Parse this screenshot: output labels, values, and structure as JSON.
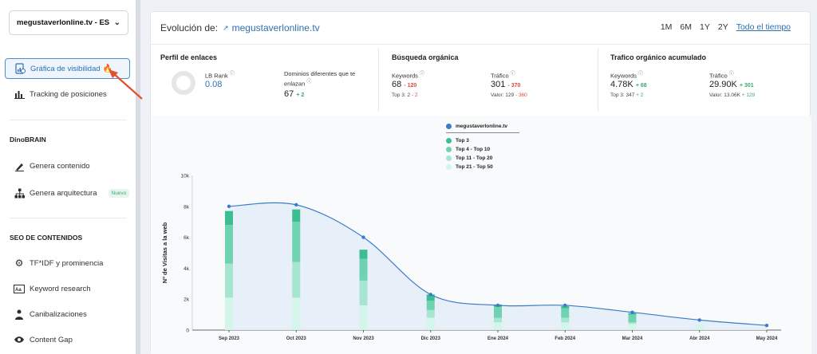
{
  "sidebar": {
    "site_select": "megustaverlonline.tv - ES",
    "items": [
      {
        "label": "Gráfica de visibilidad",
        "icon": "chart-doc-icon",
        "active": true
      },
      {
        "label": "Tracking de posiciones",
        "icon": "bar-chart-icon"
      }
    ],
    "sections": [
      {
        "title": "DinoBRAIN",
        "items": [
          {
            "label": "Genera contenido",
            "icon": "pen-icon"
          },
          {
            "label": "Genera arquitectura",
            "icon": "hierarchy-icon",
            "badge": "Nuevo"
          }
        ]
      },
      {
        "title": "SEO DE CONTENIDOS",
        "items": [
          {
            "label": "TF*IDF y prominencia",
            "icon": "gear-icon"
          },
          {
            "label": "Keyword research",
            "icon": "keyword-icon"
          },
          {
            "label": "Canibalizaciones",
            "icon": "people-icon"
          },
          {
            "label": "Content Gap",
            "icon": "eye-icon"
          }
        ]
      }
    ]
  },
  "header": {
    "title": "Evolución de:",
    "domain": "megustaverlonline.tv",
    "ranges": [
      "1M",
      "6M",
      "1Y",
      "2Y",
      "Todo el tiempo"
    ],
    "active_range": "Todo el tiempo"
  },
  "kpis": {
    "perfil": {
      "title": "Perfil de enlaces",
      "lb_rank_label": "LB Rank",
      "lb_rank_value": "0.08",
      "dominios_label": "Dominios diferentes que te enlazan",
      "dominios_value": "67",
      "dominios_delta": "+ 2"
    },
    "organica": {
      "title": "Búsqueda orgánica",
      "keywords_label": "Keywords",
      "keywords_value": "68",
      "keywords_delta": "- 120",
      "keywords_sub_prefix": "Top 3: 2",
      "keywords_sub_delta": "- 2",
      "trafico_label": "Tráfico",
      "trafico_value": "301",
      "trafico_delta": "- 370",
      "trafico_sub_prefix": "Valor: 129",
      "trafico_sub_delta": "- 360"
    },
    "acumulado": {
      "title": "Trafico orgánico acumulado",
      "keywords_label": "Keywords",
      "keywords_value": "4.78K",
      "keywords_delta": "+ 68",
      "keywords_sub_prefix": "Top 3: 347",
      "keywords_sub_delta": "+ 2",
      "trafico_label": "Tráfico",
      "trafico_value": "29.90K",
      "trafico_delta": "+ 301",
      "trafico_sub_prefix": "Valor: 13.06K",
      "trafico_sub_delta": "+ 129"
    }
  },
  "chart_data": {
    "type": "area",
    "ylabel": "Nº de Visitas a la web",
    "ylim": [
      0,
      10000
    ],
    "yticks": [
      "0",
      "2k",
      "4k",
      "6k",
      "8k",
      "10k"
    ],
    "categories": [
      "Sep 2023",
      "Oct 2023",
      "Nov 2023",
      "Dic 2023",
      "Ene 2024",
      "Feb 2024",
      "Mar 2024",
      "Abr 2024",
      "May 2024"
    ],
    "series": [
      {
        "name": "megustaverlonline.tv",
        "color": "#3b7bc8",
        "values": [
          8000,
          8100,
          6000,
          2300,
          1600,
          1600,
          1150,
          650,
          300
        ]
      },
      {
        "name": "Top 3",
        "color": "#3dbd92",
        "values": [
          900,
          800,
          600,
          400,
          150,
          150,
          100,
          0,
          0
        ]
      },
      {
        "name": "Top 4 - Top 10",
        "color": "#6fd3b1",
        "values": [
          2500,
          2600,
          1400,
          600,
          700,
          600,
          500,
          0,
          0
        ]
      },
      {
        "name": "Top 11 - Top 20",
        "color": "#a6e6d0",
        "values": [
          2200,
          2300,
          1600,
          500,
          300,
          300,
          100,
          0,
          0
        ]
      },
      {
        "name": "Top 21 - Top 50",
        "color": "#d3f5ea",
        "values": [
          2100,
          2100,
          1600,
          800,
          500,
          500,
          400,
          350,
          0
        ]
      }
    ],
    "grid": false,
    "legend": "top-center"
  },
  "colors": {
    "accent": "#2f6fb3",
    "negative": "#e0483f",
    "positive": "#3aa86b",
    "arrow": "#e2512e"
  }
}
